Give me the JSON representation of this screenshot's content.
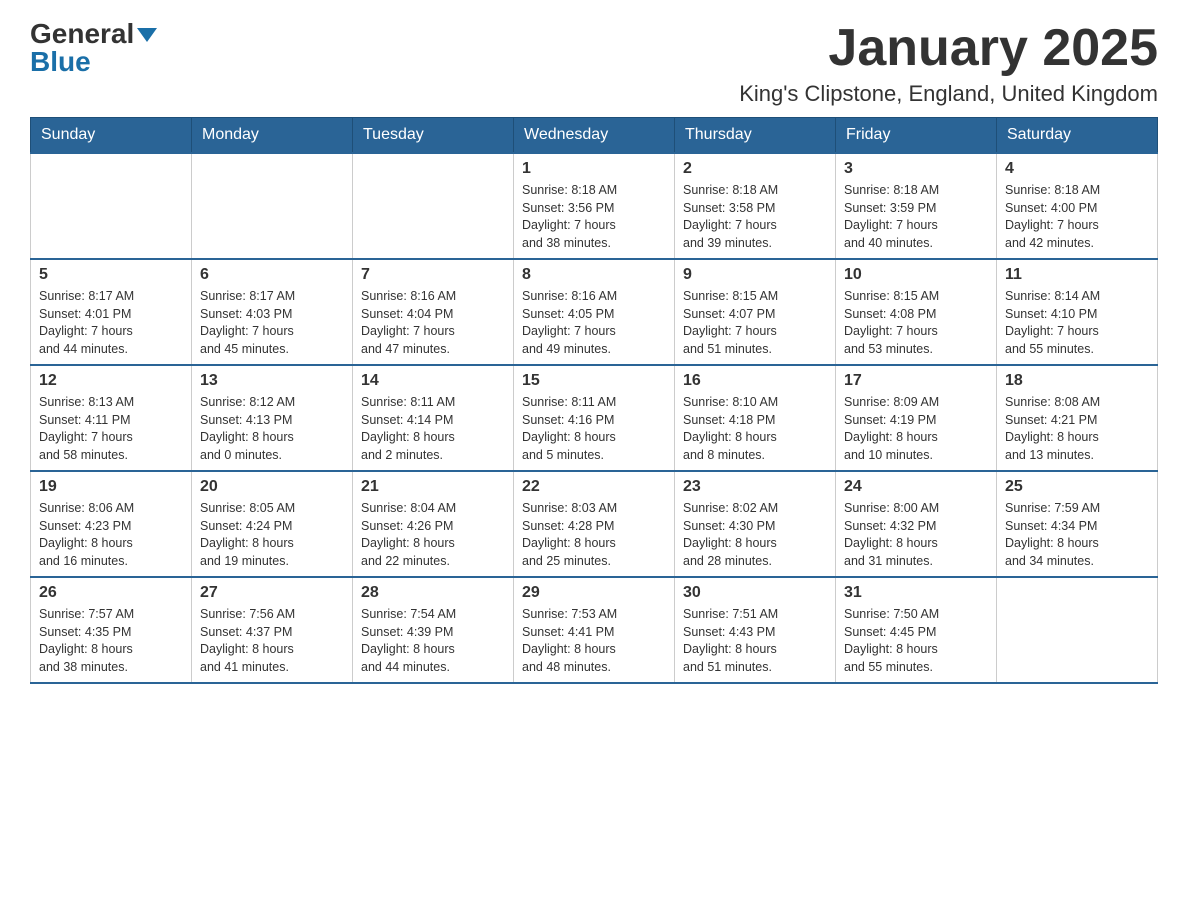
{
  "header": {
    "logo_general": "General",
    "logo_blue": "Blue",
    "month_title": "January 2025",
    "location": "King's Clipstone, England, United Kingdom"
  },
  "days_of_week": [
    "Sunday",
    "Monday",
    "Tuesday",
    "Wednesday",
    "Thursday",
    "Friday",
    "Saturday"
  ],
  "weeks": [
    [
      {
        "day": "",
        "info": ""
      },
      {
        "day": "",
        "info": ""
      },
      {
        "day": "",
        "info": ""
      },
      {
        "day": "1",
        "info": "Sunrise: 8:18 AM\nSunset: 3:56 PM\nDaylight: 7 hours\nand 38 minutes."
      },
      {
        "day": "2",
        "info": "Sunrise: 8:18 AM\nSunset: 3:58 PM\nDaylight: 7 hours\nand 39 minutes."
      },
      {
        "day": "3",
        "info": "Sunrise: 8:18 AM\nSunset: 3:59 PM\nDaylight: 7 hours\nand 40 minutes."
      },
      {
        "day": "4",
        "info": "Sunrise: 8:18 AM\nSunset: 4:00 PM\nDaylight: 7 hours\nand 42 minutes."
      }
    ],
    [
      {
        "day": "5",
        "info": "Sunrise: 8:17 AM\nSunset: 4:01 PM\nDaylight: 7 hours\nand 44 minutes."
      },
      {
        "day": "6",
        "info": "Sunrise: 8:17 AM\nSunset: 4:03 PM\nDaylight: 7 hours\nand 45 minutes."
      },
      {
        "day": "7",
        "info": "Sunrise: 8:16 AM\nSunset: 4:04 PM\nDaylight: 7 hours\nand 47 minutes."
      },
      {
        "day": "8",
        "info": "Sunrise: 8:16 AM\nSunset: 4:05 PM\nDaylight: 7 hours\nand 49 minutes."
      },
      {
        "day": "9",
        "info": "Sunrise: 8:15 AM\nSunset: 4:07 PM\nDaylight: 7 hours\nand 51 minutes."
      },
      {
        "day": "10",
        "info": "Sunrise: 8:15 AM\nSunset: 4:08 PM\nDaylight: 7 hours\nand 53 minutes."
      },
      {
        "day": "11",
        "info": "Sunrise: 8:14 AM\nSunset: 4:10 PM\nDaylight: 7 hours\nand 55 minutes."
      }
    ],
    [
      {
        "day": "12",
        "info": "Sunrise: 8:13 AM\nSunset: 4:11 PM\nDaylight: 7 hours\nand 58 minutes."
      },
      {
        "day": "13",
        "info": "Sunrise: 8:12 AM\nSunset: 4:13 PM\nDaylight: 8 hours\nand 0 minutes."
      },
      {
        "day": "14",
        "info": "Sunrise: 8:11 AM\nSunset: 4:14 PM\nDaylight: 8 hours\nand 2 minutes."
      },
      {
        "day": "15",
        "info": "Sunrise: 8:11 AM\nSunset: 4:16 PM\nDaylight: 8 hours\nand 5 minutes."
      },
      {
        "day": "16",
        "info": "Sunrise: 8:10 AM\nSunset: 4:18 PM\nDaylight: 8 hours\nand 8 minutes."
      },
      {
        "day": "17",
        "info": "Sunrise: 8:09 AM\nSunset: 4:19 PM\nDaylight: 8 hours\nand 10 minutes."
      },
      {
        "day": "18",
        "info": "Sunrise: 8:08 AM\nSunset: 4:21 PM\nDaylight: 8 hours\nand 13 minutes."
      }
    ],
    [
      {
        "day": "19",
        "info": "Sunrise: 8:06 AM\nSunset: 4:23 PM\nDaylight: 8 hours\nand 16 minutes."
      },
      {
        "day": "20",
        "info": "Sunrise: 8:05 AM\nSunset: 4:24 PM\nDaylight: 8 hours\nand 19 minutes."
      },
      {
        "day": "21",
        "info": "Sunrise: 8:04 AM\nSunset: 4:26 PM\nDaylight: 8 hours\nand 22 minutes."
      },
      {
        "day": "22",
        "info": "Sunrise: 8:03 AM\nSunset: 4:28 PM\nDaylight: 8 hours\nand 25 minutes."
      },
      {
        "day": "23",
        "info": "Sunrise: 8:02 AM\nSunset: 4:30 PM\nDaylight: 8 hours\nand 28 minutes."
      },
      {
        "day": "24",
        "info": "Sunrise: 8:00 AM\nSunset: 4:32 PM\nDaylight: 8 hours\nand 31 minutes."
      },
      {
        "day": "25",
        "info": "Sunrise: 7:59 AM\nSunset: 4:34 PM\nDaylight: 8 hours\nand 34 minutes."
      }
    ],
    [
      {
        "day": "26",
        "info": "Sunrise: 7:57 AM\nSunset: 4:35 PM\nDaylight: 8 hours\nand 38 minutes."
      },
      {
        "day": "27",
        "info": "Sunrise: 7:56 AM\nSunset: 4:37 PM\nDaylight: 8 hours\nand 41 minutes."
      },
      {
        "day": "28",
        "info": "Sunrise: 7:54 AM\nSunset: 4:39 PM\nDaylight: 8 hours\nand 44 minutes."
      },
      {
        "day": "29",
        "info": "Sunrise: 7:53 AM\nSunset: 4:41 PM\nDaylight: 8 hours\nand 48 minutes."
      },
      {
        "day": "30",
        "info": "Sunrise: 7:51 AM\nSunset: 4:43 PM\nDaylight: 8 hours\nand 51 minutes."
      },
      {
        "day": "31",
        "info": "Sunrise: 7:50 AM\nSunset: 4:45 PM\nDaylight: 8 hours\nand 55 minutes."
      },
      {
        "day": "",
        "info": ""
      }
    ]
  ]
}
